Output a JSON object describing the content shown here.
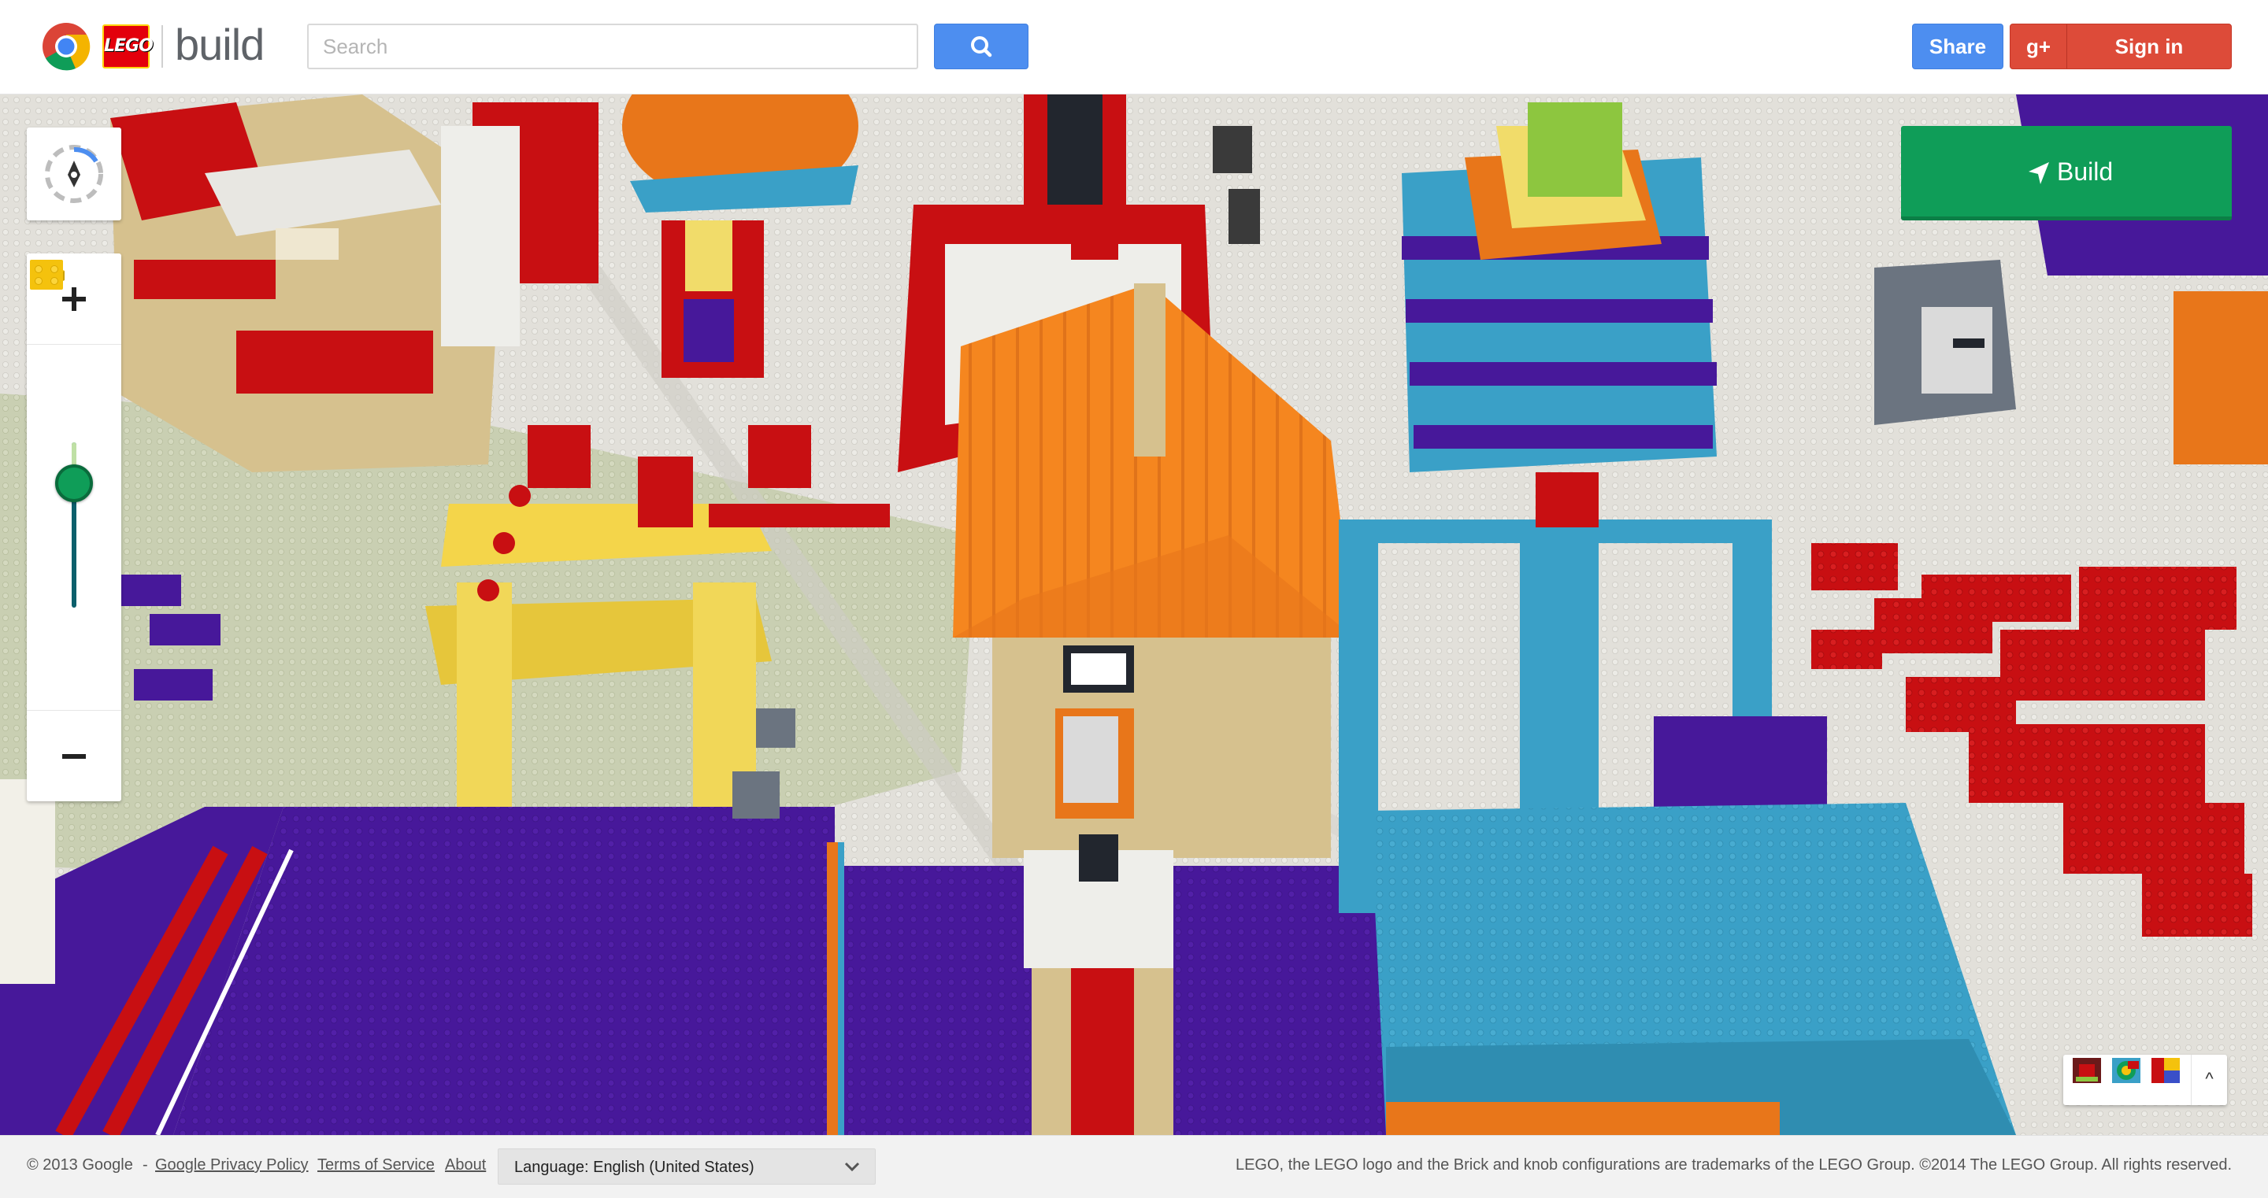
{
  "header": {
    "brand": "build",
    "lego_logo_text": "LEGO",
    "search": {
      "placeholder": "Search",
      "value": ""
    },
    "share_label": "Share",
    "gplus_label": "g+",
    "signin_label": "Sign in"
  },
  "controls": {
    "build_label": "Build",
    "palette_toggle": "^"
  },
  "footer": {
    "copyright": "© 2013 Google",
    "separator": "-",
    "privacy_link": "Google Privacy Policy",
    "terms_link": "Terms of Service",
    "about_link": "About",
    "language_select": "Language: English (United States)",
    "legal": "LEGO, the LEGO logo and the Brick and knob configurations are trademarks of the LEGO Group. ©2014 The LEGO Group. All rights reserved."
  },
  "colors": {
    "accent_blue": "#4d8ef0",
    "google_red": "#dd4b39",
    "build_green": "#0f9d58",
    "lego_red": "#e3000b",
    "lego_yellow": "#ffd200"
  },
  "icons": [
    "chrome-logo-icon",
    "search-icon",
    "compass-icon",
    "plus-icon",
    "brick-icon",
    "flat-brick-icon",
    "minus-icon",
    "navigation-arrow-icon",
    "chevron-down-icon",
    "chevron-up-icon"
  ]
}
